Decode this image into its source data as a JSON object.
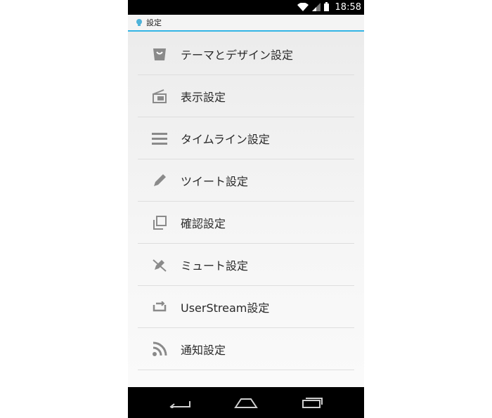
{
  "status_bar": {
    "time": "18:58"
  },
  "action_bar": {
    "title": "設定"
  },
  "settings": {
    "items": [
      {
        "label": "テーマとデザイン設定",
        "icon": "shopping-bag-icon"
      },
      {
        "label": "表示設定",
        "icon": "display-icon"
      },
      {
        "label": "タイムライン設定",
        "icon": "menu-lines-icon"
      },
      {
        "label": "ツイート設定",
        "icon": "pencil-icon"
      },
      {
        "label": "確認設定",
        "icon": "copy-icon"
      },
      {
        "label": "ミュート設定",
        "icon": "mute-icon"
      },
      {
        "label": "UserStream設定",
        "icon": "stream-icon"
      },
      {
        "label": "通知設定",
        "icon": "rss-icon"
      }
    ]
  },
  "colors": {
    "accent": "#33b5e5",
    "icon": "#8a8a8a",
    "text": "#2a2a2a"
  },
  "nav": {
    "back": "back-icon",
    "home": "home-icon",
    "recents": "recents-icon"
  }
}
